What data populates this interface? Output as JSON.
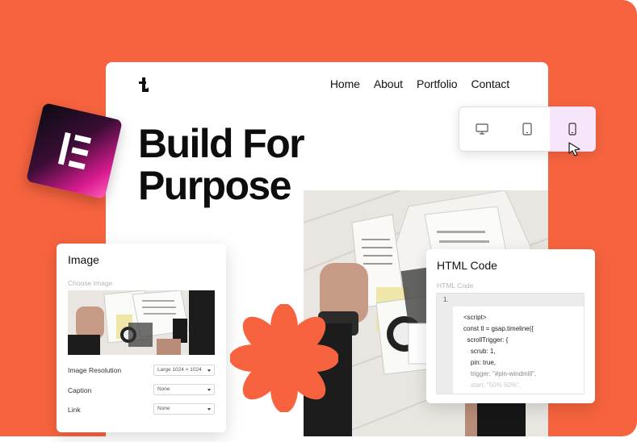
{
  "colors": {
    "accent": "#f7633f",
    "tablet_active": "#f7e6fb",
    "elementor_pink": "#d81b8f"
  },
  "site": {
    "logo_icon": "t-logo-icon",
    "nav": [
      "Home",
      "About",
      "Portfolio",
      "Contact"
    ],
    "hero_line1": "Build For",
    "hero_line2": "Purpose"
  },
  "badge": {
    "icon": "elementor-logo-icon"
  },
  "device_toggle": {
    "options": [
      "desktop-icon",
      "tablet-icon",
      "mobile-icon"
    ],
    "active": "mobile-icon"
  },
  "image_panel": {
    "title": "Image",
    "choose_label": "Choose Image",
    "rows": [
      {
        "label": "Image Resolution",
        "value": "Large 1024 × 1024"
      },
      {
        "label": "Caption",
        "value": "None"
      },
      {
        "label": "Link",
        "value": "None"
      }
    ]
  },
  "html_panel": {
    "title": "HTML Code",
    "field_label": "HTML Code",
    "line_number": "1.",
    "code_lines": [
      "<script>",
      "const tl = gsap.timeline({",
      "  scrollTrigger: {",
      "    scrub: 1,",
      "    pin: true,",
      "    trigger: \"#pin-windmill\",",
      "    start: \"50% 50%\","
    ]
  }
}
